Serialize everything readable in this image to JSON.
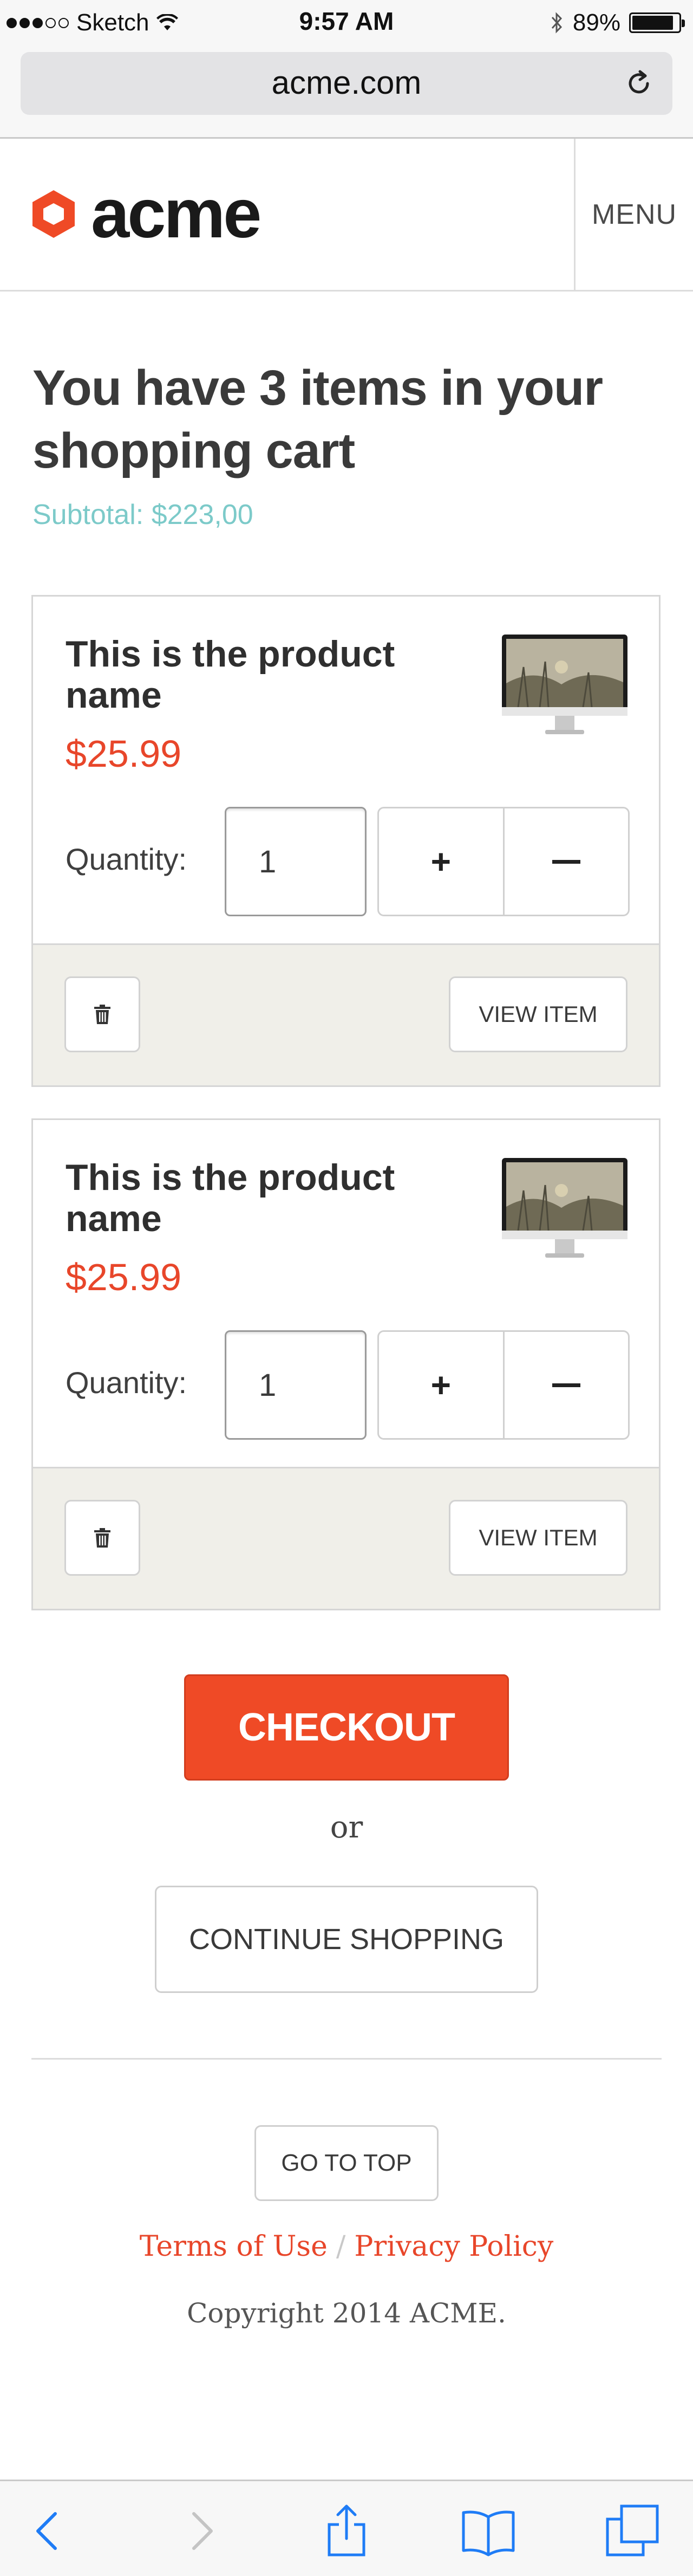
{
  "status_bar": {
    "carrier": "Sketch",
    "time": "9:57 AM",
    "battery_percent": "89%",
    "battery_level": 0.89,
    "signal_bars_filled": 3,
    "signal_bars_total": 5
  },
  "browser": {
    "url": "acme.com"
  },
  "header": {
    "logo_text": "acme",
    "menu_label": "MENU",
    "brand_color": "#ef4a26"
  },
  "cart": {
    "title": "You have 3 items in your shopping cart",
    "subtotal": "Subtotal: $223,00",
    "items": [
      {
        "name": "This is the product name",
        "price": "$25.99",
        "quantity_label": "Quantity:",
        "quantity": "1",
        "plus_label": "+",
        "view_label": "VIEW ITEM"
      },
      {
        "name": "This is the product name",
        "price": "$25.99",
        "quantity_label": "Quantity:",
        "quantity": "1",
        "plus_label": "+",
        "view_label": "VIEW ITEM"
      }
    ],
    "checkout_label": "CHECKOUT",
    "or_text": "or",
    "continue_label": "CONTINUE SHOPPING"
  },
  "footer": {
    "top_label": "GO TO TOP",
    "terms_label": "Terms of Use",
    "separator": "/",
    "privacy_label": "Privacy Policy",
    "copyright": "Copyright 2014 ACME."
  },
  "icons": {
    "wifi": "wifi-icon",
    "bluetooth": "bluetooth-icon",
    "reload": "reload-icon",
    "trash": "trash-icon",
    "back": "back-icon",
    "forward": "forward-icon",
    "share": "share-icon",
    "bookmarks": "bookmarks-icon",
    "tabs": "tabs-icon"
  },
  "colors": {
    "accent": "#ef4a26",
    "subtotal": "#7ccac9",
    "ios_blue": "#1f7cf6",
    "footer_bg": "#f0efe9"
  }
}
